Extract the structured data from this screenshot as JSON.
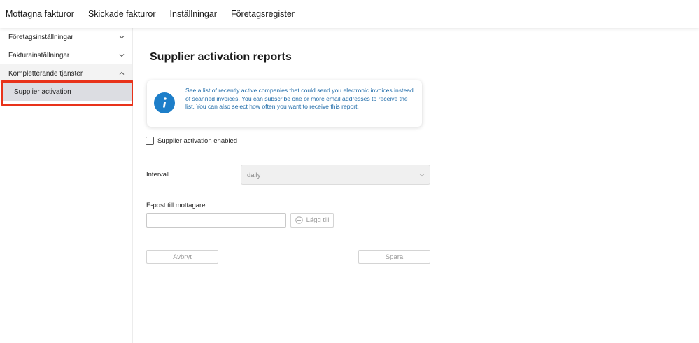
{
  "topnav": {
    "items": [
      {
        "label": "Mottagna fakturor"
      },
      {
        "label": "Skickade fakturor"
      },
      {
        "label": "Inställningar"
      },
      {
        "label": "Företagsregister"
      }
    ]
  },
  "sidebar": {
    "items": [
      {
        "label": "Företagsinställningar",
        "expanded": false
      },
      {
        "label": "Fakturainställningar",
        "expanded": false
      },
      {
        "label": "Kompletterande tjänster",
        "expanded": true
      }
    ],
    "subitem": {
      "label": "Supplier activation",
      "selected": true
    }
  },
  "main": {
    "title": "Supplier activation reports",
    "info": {
      "icon": "info-icon",
      "text": "See a list of recently active companies that could send you electronic invoices instead of scanned invoices. You can subscribe one or more email addresses to receive the list. You can also select how often you want to receive this report."
    },
    "checkbox": {
      "label": "Supplier activation enabled",
      "checked": false
    },
    "interval": {
      "label": "Intervall",
      "value": "daily"
    },
    "email": {
      "label": "E-post till mottagare",
      "value": "",
      "add_label": "Lägg till"
    },
    "buttons": {
      "cancel": "Avbryt",
      "save": "Spara"
    }
  },
  "colors": {
    "accent": "#1d7ec9",
    "info_text": "#1d6aa8",
    "highlight": "#e8321a",
    "selected_bg": "#dcdde2"
  }
}
